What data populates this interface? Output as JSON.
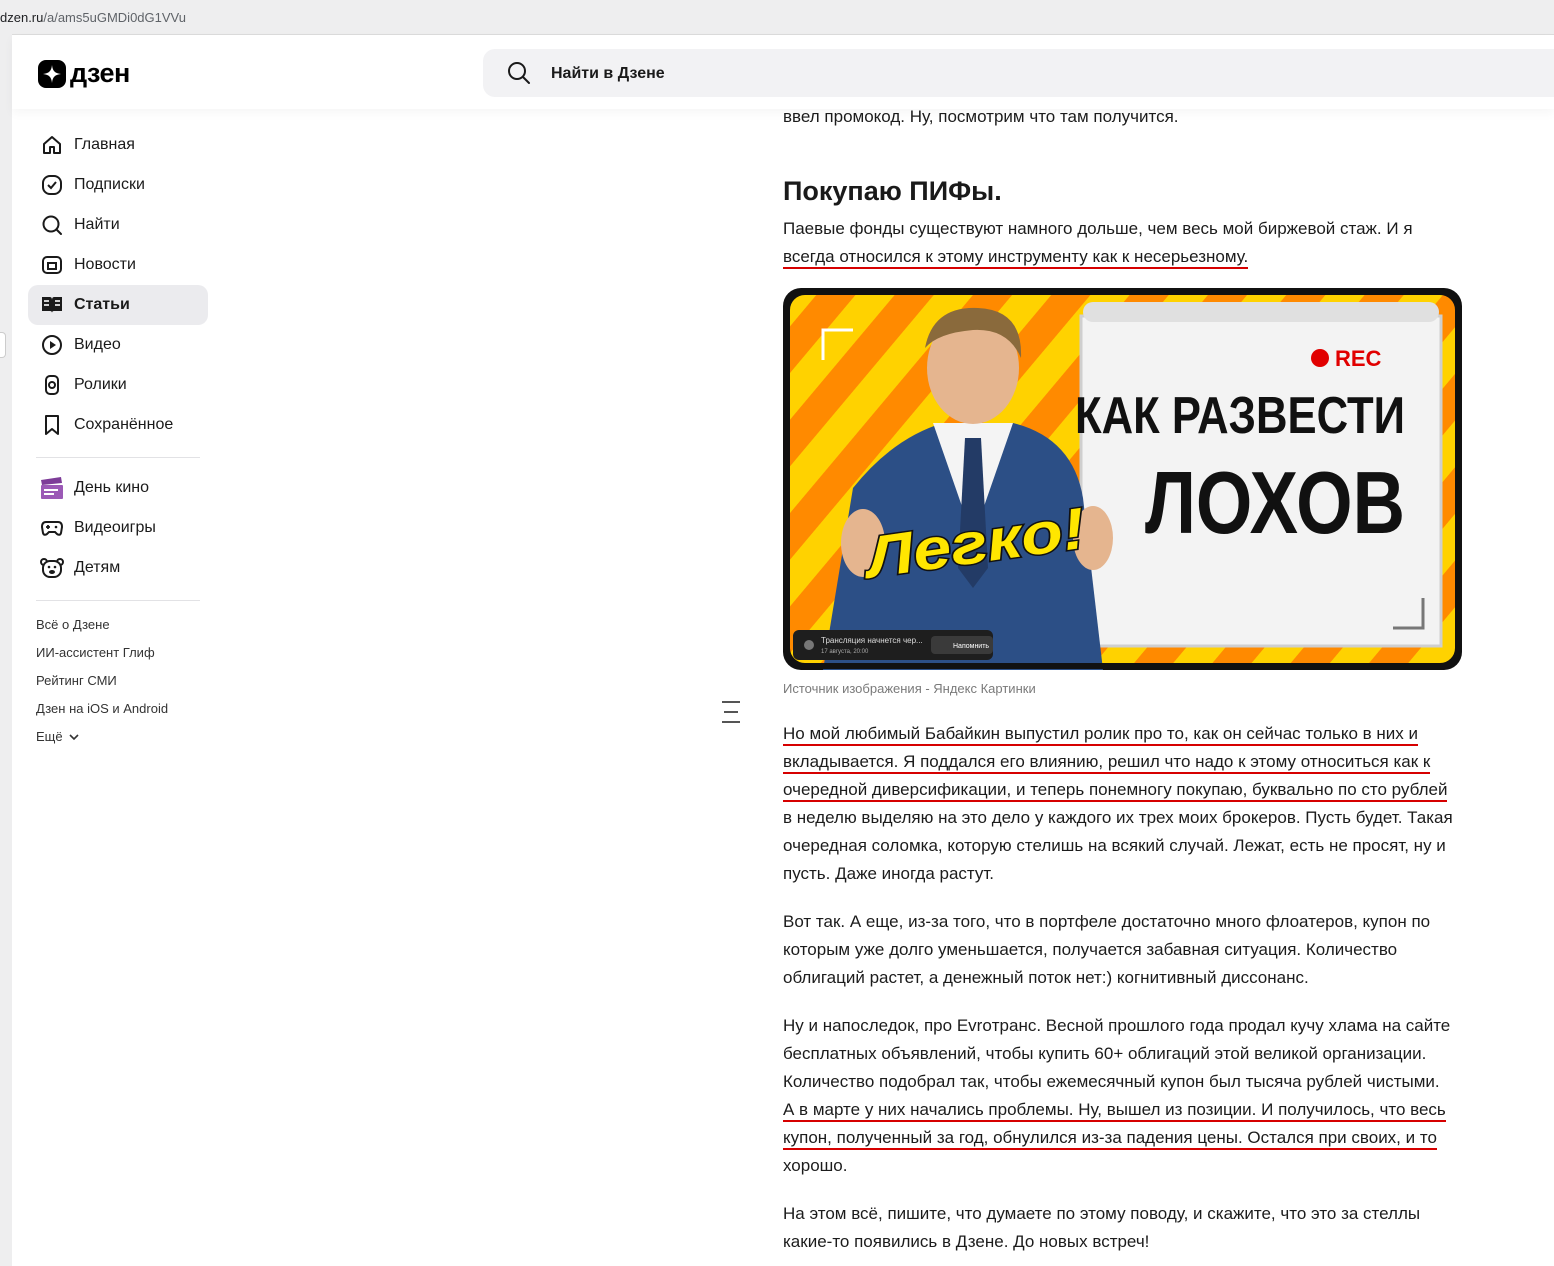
{
  "browser": {
    "url_host": "dzen.ru",
    "url_path": "/a/ams5uGMDi0dG1VVu"
  },
  "header": {
    "logo_text": "дзен",
    "search_placeholder": "Найти в Дзене"
  },
  "sidebar": {
    "items": [
      {
        "label": "Главная",
        "icon": "home-icon"
      },
      {
        "label": "Подписки",
        "icon": "subscriptions-icon"
      },
      {
        "label": "Найти",
        "icon": "search-icon"
      },
      {
        "label": "Новости",
        "icon": "news-icon"
      },
      {
        "label": "Статьи",
        "icon": "articles-icon",
        "active": true
      },
      {
        "label": "Видео",
        "icon": "video-icon"
      },
      {
        "label": "Ролики",
        "icon": "shorts-icon"
      },
      {
        "label": "Сохранённое",
        "icon": "bookmark-icon"
      }
    ],
    "extra_items": [
      {
        "label": "День кино",
        "icon": "clapperboard-icon"
      },
      {
        "label": "Видеоигры",
        "icon": "gamepad-icon"
      },
      {
        "label": "Детям",
        "icon": "bear-icon"
      }
    ],
    "footer_links": [
      "Всё о Дзене",
      "ИИ-ассистент Глиф",
      "Рейтинг СМИ",
      "Дзен на iOS и Android",
      "Ещё"
    ]
  },
  "article": {
    "intro_tail": "ввел промокод. Ну, посмотрим что там получится.",
    "heading": "Покупаю ПИФы.",
    "p1_a": "Паевые фонды существуют намного дольше, чем весь мой биржевой стаж. И я",
    "p1_b": "всегда относился к этому инструменту как к несерьезному.",
    "image": {
      "rec": "REC",
      "line1": "КАК РАЗВЕСТИ",
      "line2": "ЛОХОВ",
      "badge": "Легко!",
      "stream_text": "Трансляция начнется чер...",
      "stream_date": "17 августа, 20:00",
      "remind": "Напомнить"
    },
    "image_caption": "Источник изображения - Яндекс Картинки",
    "p2": [
      "Но мой любимый Бабайкин выпустил ролик про то, как он сейчас только в них и",
      "вкладывается. Я поддался его влиянию, решил что надо к этому относиться как к",
      "очередной диверсификации, и теперь понемногу покупаю, буквально по сто рублей",
      "в неделю выделяю на это дело у каждого их трех моих брокеров. Пусть будет. Такая",
      "очередная соломка, которую стелишь на всякий случай. Лежат, есть не просят, ну и",
      "пусть. Даже иногда растут."
    ],
    "p3": [
      "Вот так. А еще, из-за того, что в портфеле достаточно много флоатеров, купон по",
      "которым уже долго уменьшается, получается забавная ситуация. Количество",
      "облигаций растет, а денежный поток нет:) когнитивный диссонанс."
    ],
    "p4": [
      "Ну и напоследок, про Evroтранс. Весной прошлого года продал кучу хлама на сайте",
      "бесплатных объявлений, чтобы купить 60+ облигаций этой великой организации.",
      "Количество подобрал так, чтобы ежемесячный купон был тысяча рублей чистыми.",
      "А в марте у них начались проблемы. Ну, вышел из позиции. И получилось, что весь",
      "купон, полученный за год, обнулился из-за падения цены. Остался при своих, и то",
      "хорошо."
    ],
    "p5": [
      "На этом всё, пишите, что думаете по этому поводу, и скажите, что это за стеллы",
      "какие-то появились в Дзене. До новых встреч!"
    ]
  },
  "colors": {
    "accent_underline": "#d60000",
    "active_nav_bg": "#ebebee",
    "search_bg": "#f2f2f4"
  }
}
